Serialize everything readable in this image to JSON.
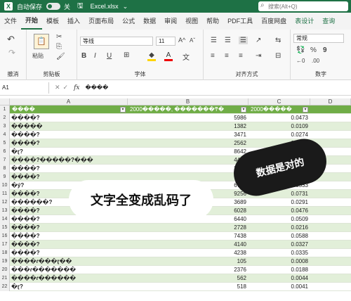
{
  "titlebar": {
    "logo": "X",
    "autosave_label": "自动保存",
    "autosave_state": "关",
    "filename": "Excel.xlsx",
    "search_placeholder": "搜索(Alt+Q)"
  },
  "tabs": [
    "文件",
    "开始",
    "模板",
    "插入",
    "页面布局",
    "公式",
    "数据",
    "审阅",
    "视图",
    "帮助",
    "PDF工具",
    "百度网盘",
    "表设计",
    "查询"
  ],
  "ribbon": {
    "groups": [
      "撤消",
      "剪贴板",
      "字体",
      "对齐方式",
      "数字"
    ],
    "paste_label": "粘贴",
    "font_name": "等线",
    "font_size": "11",
    "number_format": "常规",
    "bold": "B",
    "italic": "I",
    "underline": "U"
  },
  "formula_bar": {
    "cell_ref": "A1",
    "fx": "fx",
    "content": "����"
  },
  "columns": [
    "A",
    "B",
    "C",
    "D"
  ],
  "header_row": {
    "a": "����",
    "b": "2000�����, �������ͳ�",
    "c": "2000�����"
  },
  "rows": [
    {
      "n": "2",
      "a": "����?",
      "b": "5986",
      "c": "0.0473"
    },
    {
      "n": "3",
      "a": "�����",
      "b": "1382",
      "c": "0.0109"
    },
    {
      "n": "4",
      "a": "����?",
      "b": "3471",
      "c": "0.0274"
    },
    {
      "n": "5",
      "a": "����?",
      "b": "2562",
      "c": "0.0202"
    },
    {
      "n": "6",
      "a": "�ɽ?",
      "b": "8642",
      "c": "0.0683"
    },
    {
      "n": "7",
      "a": "         ����?�����?���",
      "b": "4489",
      "c": ""
    },
    {
      "n": "8",
      "a": "����?",
      "b": "3328",
      "c": ""
    },
    {
      "n": "9",
      "a": "����?",
      "b": "7787",
      "c": ""
    },
    {
      "n": "10",
      "a": "�ý?",
      "b": "6745",
      "c": "0.0533"
    },
    {
      "n": "11",
      "a": "����?",
      "b": "9256",
      "c": "0.0731"
    },
    {
      "n": "12",
      "a": "������?",
      "b": "3689",
      "c": "0.0291"
    },
    {
      "n": "13",
      "a": "����?",
      "b": "6028",
      "c": "0.0476"
    },
    {
      "n": "14",
      "a": "����?",
      "b": "6440",
      "c": "0.0509"
    },
    {
      "n": "15",
      "a": "����?",
      "b": "2728",
      "c": "0.0216"
    },
    {
      "n": "16",
      "a": "����?",
      "b": "7438",
      "c": "0.0588"
    },
    {
      "n": "17",
      "a": "����?",
      "b": "4140",
      "c": "0.0327"
    },
    {
      "n": "18",
      "a": "����?",
      "b": "4238",
      "c": "0.0335"
    },
    {
      "n": "19",
      "a": "����ɾ���ɽ��",
      "b": "105",
      "c": "0.0008"
    },
    {
      "n": "20",
      "a": "���ɾ�������",
      "b": "2376",
      "c": "0.0188"
    },
    {
      "n": "21",
      "a": "����ɾ������",
      "b": "562",
      "c": "0.0044"
    },
    {
      "n": "22",
      "a": "�ɽ?",
      "b": "518",
      "c": "0.0041"
    }
  ],
  "overlay_text_1": "文字全变成乱码了",
  "overlay_text_2": "数据是对的"
}
